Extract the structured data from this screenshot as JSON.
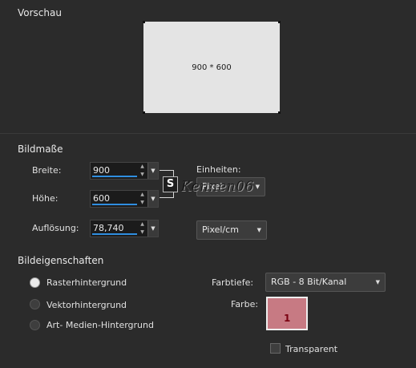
{
  "preview": {
    "title": "Vorschau",
    "size_text": "900 * 600"
  },
  "dimensions": {
    "title": "Bildmaße",
    "width_label": "Breite:",
    "width_value": "900",
    "height_label": "Höhe:",
    "height_value": "600",
    "resolution_label": "Auflösung:",
    "resolution_value": "78,740",
    "units_label": "Einheiten:",
    "units_value": "Pixel",
    "resolution_unit_value": "Pixel/cm",
    "link_icon": "link-aspect-ratio-icon"
  },
  "properties": {
    "title": "Bildeigenschaften",
    "background_options": [
      {
        "label": "Rasterhintergrund",
        "selected": true
      },
      {
        "label": "Vektorhintergrund",
        "selected": false
      },
      {
        "label": "Art- Medien-Hintergrund",
        "selected": false
      }
    ],
    "color_depth_label": "Farbtiefe:",
    "color_depth_value": "RGB - 8 Bit/Kanal",
    "color_label": "Farbe:",
    "color_swatch": "#c77a83",
    "color_marker": "1",
    "transparent_label": "Transparent",
    "transparent_checked": false
  },
  "watermark": "Kennen06"
}
